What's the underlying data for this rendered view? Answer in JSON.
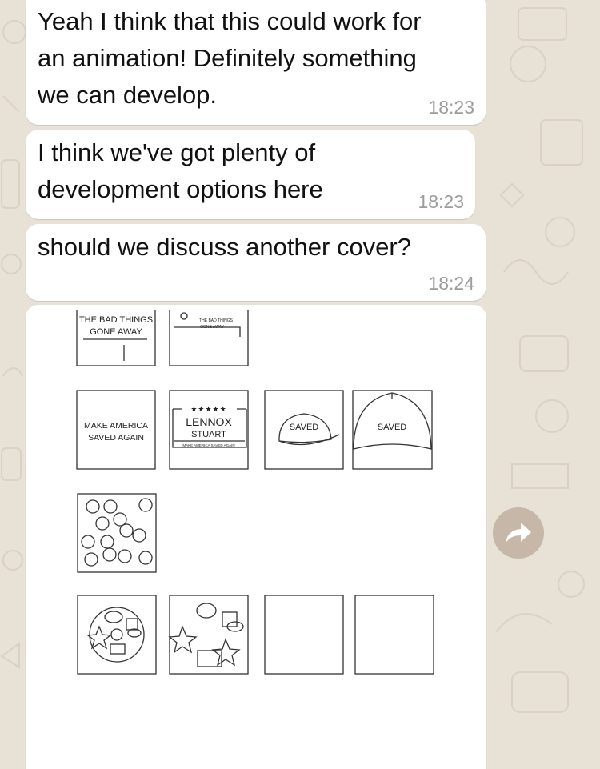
{
  "messages": [
    {
      "text": "Yeah I think that this could work for\nan animation! Definitely something\nwe can develop.",
      "time": "18:23"
    },
    {
      "text": "I think we've got plenty of\ndevelopment options here",
      "time": "18:23"
    },
    {
      "text": "should we discuss another cover?",
      "time": "18:24"
    }
  ],
  "image": {
    "sketch_labels": {
      "bad_things_1": "THE BAD THINGS",
      "bad_things_2": "GONE AWAY",
      "bad_things_small_1": "THE BAD THINGS",
      "bad_things_small_2": "GONE AWAY",
      "make_america_1": "MAKE AMERICA",
      "make_america_2": "SAVED AGAIN",
      "lennox_stars": "★★★★★",
      "lennox_1": "LENNOX",
      "lennox_2": "STUART",
      "lennox_small": "MAKE AMERICA SAVED AGAIN",
      "saved_cap": "SAVED",
      "saved_cap_2": "SAVED"
    }
  },
  "colors": {
    "bubble": "#ffffff",
    "background": "#e7e1d6",
    "forward_button": "#c6b7a9"
  },
  "icons": {
    "forward": "forward-arrow-icon"
  }
}
